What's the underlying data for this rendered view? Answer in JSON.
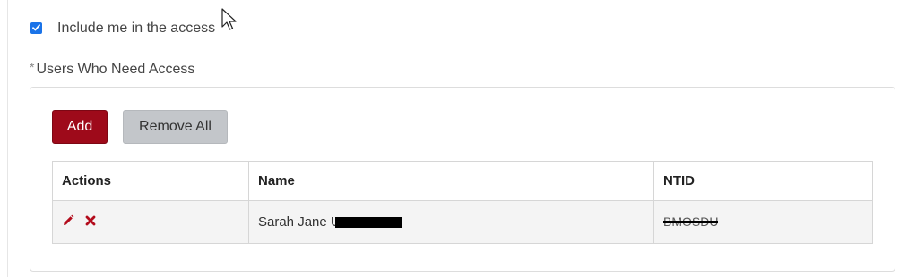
{
  "include_me": {
    "label": "Include me in the access",
    "checked": true
  },
  "section": {
    "required_mark": "*",
    "label": "Users Who Need Access"
  },
  "buttons": {
    "add": "Add",
    "remove_all": "Remove All"
  },
  "table": {
    "headers": [
      "Actions",
      "Name",
      "NTID"
    ],
    "rows": [
      {
        "actions": [
          "edit-icon",
          "delete-icon"
        ],
        "name": "Sarah Jane U",
        "ntid": "BMOSDU"
      }
    ]
  },
  "colors": {
    "primary_button": "#9e0a1a",
    "secondary_button": "#c3c6ca",
    "checkbox": "#1a73e8",
    "action_icons": "#b30c1c"
  }
}
